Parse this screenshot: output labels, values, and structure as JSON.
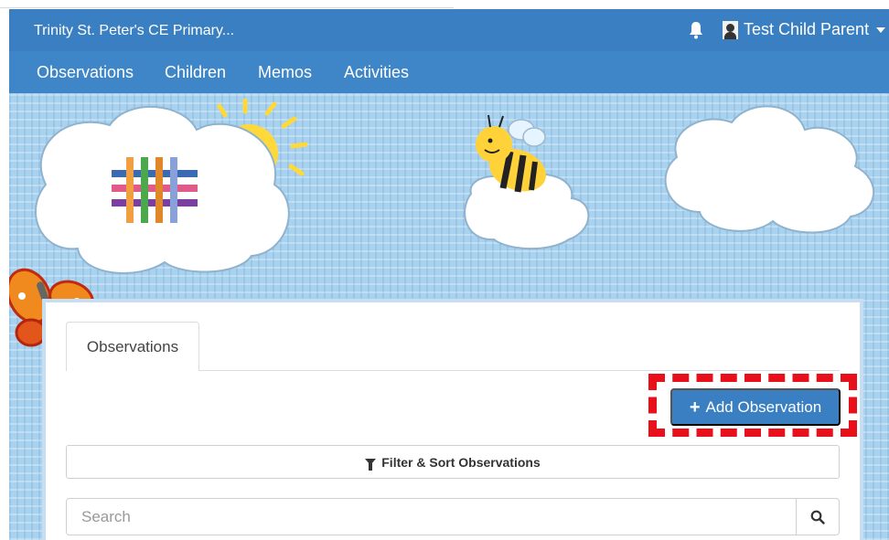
{
  "header": {
    "school_name": "Trinity St. Peter's CE Primary...",
    "user_name": "Test Child Parent"
  },
  "nav": {
    "items": [
      {
        "label": "Observations"
      },
      {
        "label": "Children"
      },
      {
        "label": "Memos"
      },
      {
        "label": "Activities"
      }
    ]
  },
  "main": {
    "tab_label": "Observations",
    "add_button_label": "Add Observation",
    "filter_label": "Filter & Sort Observations",
    "search_placeholder": "Search"
  },
  "icons": {
    "bell": "bell-icon",
    "user": "user-icon",
    "plus": "plus-icon",
    "filter": "filter-icon",
    "search": "search-icon"
  },
  "colors": {
    "header_bar": "#3a7fc1",
    "nav_bar": "#3e86c8",
    "primary_button": "#3a7fc1",
    "highlight_box": "#e8101a",
    "sky": "#a9d2ef"
  }
}
